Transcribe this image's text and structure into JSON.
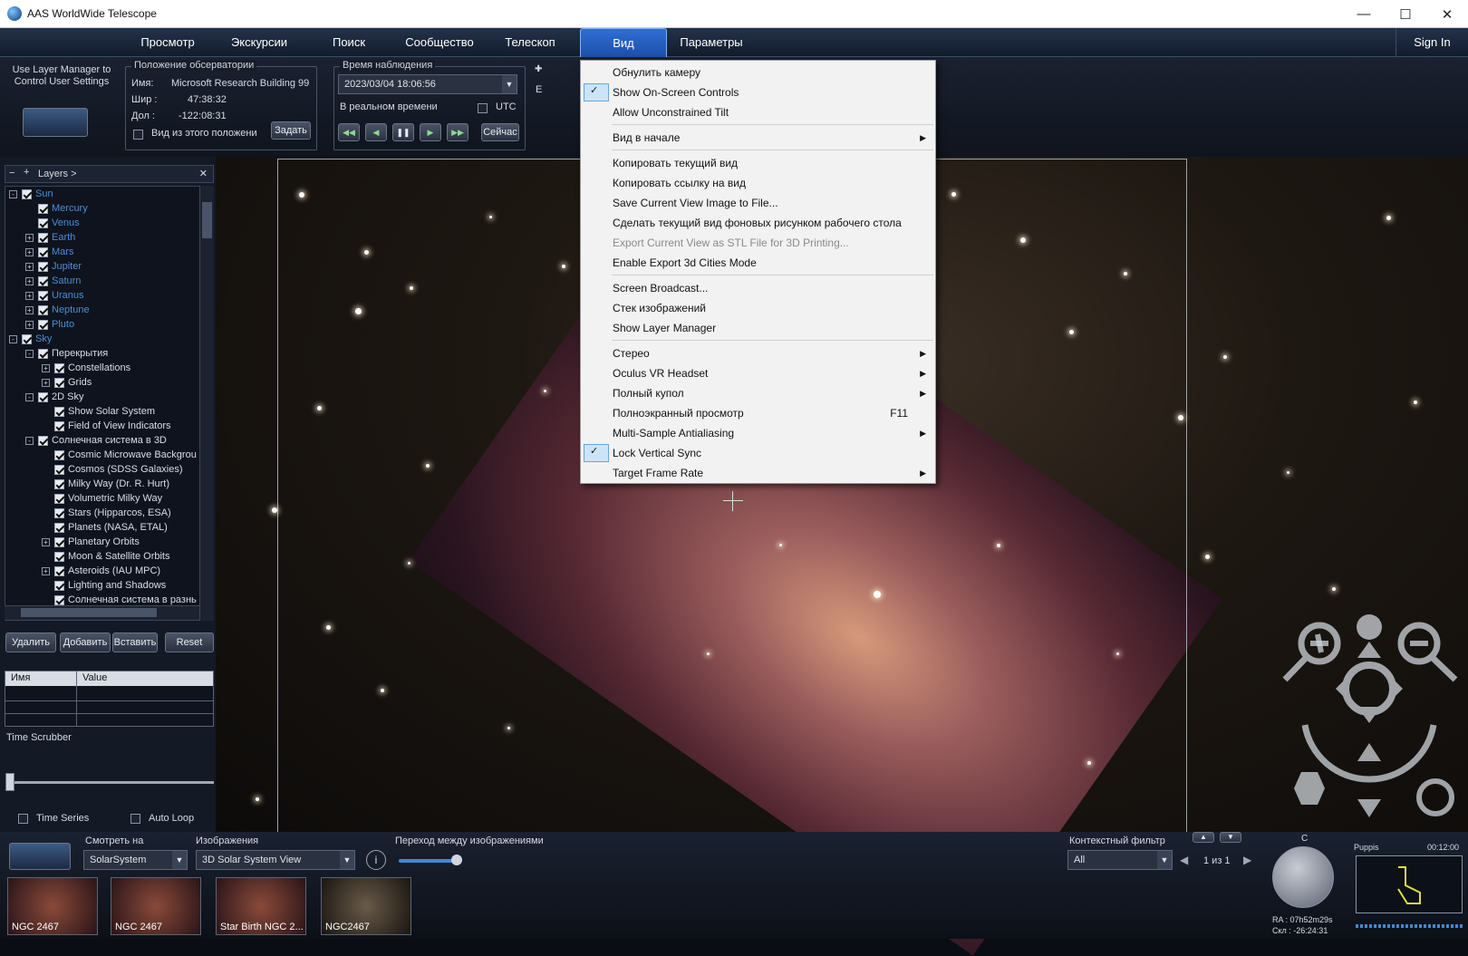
{
  "window": {
    "title": "AAS WorldWide Telescope",
    "min": "—",
    "max": "☐",
    "close": "✕"
  },
  "menubar": {
    "items": [
      "Просмотр",
      "Экскурсии",
      "Поиск",
      "Сообщество",
      "Телескоп",
      "Вид",
      "Параметры"
    ],
    "signin": "Sign In"
  },
  "observatory": {
    "layer_manager_hint": "Use Layer Manager to Control User Settings",
    "group": "Положение обсерватории",
    "name_label": "Имя:",
    "name": "Microsoft Research Building 99",
    "lat_label": "Шир :",
    "lat": "47:38:32",
    "lon_label": "Дол :",
    "lon": "-122:08:31",
    "view_from": "Вид из этого положени",
    "set_button": "Задать"
  },
  "time": {
    "group": "Время наблюдения",
    "datetime": "2023/03/04   18:06:56",
    "realtime": "В реальном времени",
    "utc": "UTC",
    "now_button": "Сейчас",
    "e_label": "E"
  },
  "layers": {
    "header": "Layers >",
    "rows": [
      {
        "label": "Sun",
        "indent": 0,
        "exp": "-",
        "blue": true
      },
      {
        "label": "Mercury",
        "indent": 1,
        "exp": "",
        "blue": true
      },
      {
        "label": "Venus",
        "indent": 1,
        "exp": "",
        "blue": true
      },
      {
        "label": "Earth",
        "indent": 1,
        "exp": "+",
        "blue": true
      },
      {
        "label": "Mars",
        "indent": 1,
        "exp": "+",
        "blue": true
      },
      {
        "label": "Jupiter",
        "indent": 1,
        "exp": "+",
        "blue": true
      },
      {
        "label": "Saturn",
        "indent": 1,
        "exp": "+",
        "blue": true
      },
      {
        "label": "Uranus",
        "indent": 1,
        "exp": "+",
        "blue": true
      },
      {
        "label": "Neptune",
        "indent": 1,
        "exp": "+",
        "blue": true
      },
      {
        "label": "Pluto",
        "indent": 1,
        "exp": "+",
        "blue": true
      },
      {
        "label": "Sky",
        "indent": 0,
        "exp": "-",
        "blue": true
      },
      {
        "label": "Перекрытия",
        "indent": 1,
        "exp": "-",
        "blue": false
      },
      {
        "label": "Constellations",
        "indent": 2,
        "exp": "+",
        "blue": false
      },
      {
        "label": "Grids",
        "indent": 2,
        "exp": "+",
        "blue": false
      },
      {
        "label": "2D Sky",
        "indent": 1,
        "exp": "-",
        "blue": false
      },
      {
        "label": "Show Solar System",
        "indent": 2,
        "exp": "",
        "blue": false
      },
      {
        "label": "Field of View Indicators",
        "indent": 2,
        "exp": "",
        "blue": false
      },
      {
        "label": "Солнечная система в 3D",
        "indent": 1,
        "exp": "-",
        "blue": false
      },
      {
        "label": "Cosmic Microwave Backgrou",
        "indent": 2,
        "exp": "",
        "blue": false
      },
      {
        "label": "Cosmos (SDSS Galaxies)",
        "indent": 2,
        "exp": "",
        "blue": false
      },
      {
        "label": "Milky Way (Dr. R. Hurt)",
        "indent": 2,
        "exp": "",
        "blue": false
      },
      {
        "label": "Volumetric Milky Way",
        "indent": 2,
        "exp": "",
        "blue": false
      },
      {
        "label": "Stars (Hipparcos, ESA)",
        "indent": 2,
        "exp": "",
        "blue": false
      },
      {
        "label": "Planets (NASA, ETAL)",
        "indent": 2,
        "exp": "",
        "blue": false
      },
      {
        "label": "Planetary Orbits",
        "indent": 2,
        "exp": "+",
        "blue": false
      },
      {
        "label": "Moon & Satellite Orbits",
        "indent": 2,
        "exp": "",
        "blue": false
      },
      {
        "label": "Asteroids (IAU MPC)",
        "indent": 2,
        "exp": "+",
        "blue": false
      },
      {
        "label": "Lighting and Shadows",
        "indent": 2,
        "exp": "",
        "blue": false
      },
      {
        "label": "Солнечная система в разнь",
        "indent": 2,
        "exp": "",
        "blue": false
      }
    ],
    "buttons": [
      "Удалить",
      "Добавить",
      "Вставить",
      "Reset"
    ],
    "col_name": "Имя",
    "col_value": "Value",
    "time_scrubber": "Time Scrubber",
    "time_series": "Time Series",
    "auto_loop": "Auto Loop"
  },
  "view_menu": {
    "items": [
      {
        "label": "Обнулить камеру"
      },
      {
        "label": "Show On-Screen Controls",
        "checked": true
      },
      {
        "label": "Allow Unconstrained Tilt"
      },
      {
        "sep": true
      },
      {
        "label": "Вид в начале",
        "sub": true
      },
      {
        "sep": true
      },
      {
        "label": "Копировать текущий вид"
      },
      {
        "label": "Копировать ссылку на вид"
      },
      {
        "label": "Save Current View Image to File..."
      },
      {
        "label": "Сделать текущий вид фоновых рисунком рабочего стола"
      },
      {
        "label": "Export Current View as STL File for 3D Printing...",
        "disabled": true
      },
      {
        "label": "Enable Export 3d Cities Mode"
      },
      {
        "sep": true
      },
      {
        "label": "Screen Broadcast..."
      },
      {
        "label": "Стек изображений"
      },
      {
        "label": "Show Layer Manager"
      },
      {
        "sep": true
      },
      {
        "label": "Стерео",
        "sub": true
      },
      {
        "label": "Oculus VR Headset",
        "sub": true
      },
      {
        "label": "Полный купол",
        "sub": true
      },
      {
        "label": "Полноэкранный просмотр",
        "shortcut": "F11"
      },
      {
        "label": "Multi-Sample Antialiasing",
        "sub": true
      },
      {
        "label": "Lock Vertical Sync",
        "checked": true
      },
      {
        "label": "Target Frame Rate",
        "sub": true
      }
    ]
  },
  "bottom": {
    "look_at_label": "Смотреть на",
    "look_at": "SolarSystem",
    "imagery_label": "Изображения",
    "imagery": "3D Solar System View",
    "transition": "Переход между изображениями",
    "context_filter": "Контекстный фильтр",
    "filter": "All",
    "paging": "1 из 1",
    "thumbs": [
      "NGC 2467",
      "NGC 2467",
      "Star Birth NGC 2...",
      "NGC2467"
    ],
    "c_label": "C",
    "ra": "RA : 07h52m29s",
    "dec": "Скл : -26:24:31",
    "constellation": "Puppis",
    "clock": "00:12:00"
  }
}
